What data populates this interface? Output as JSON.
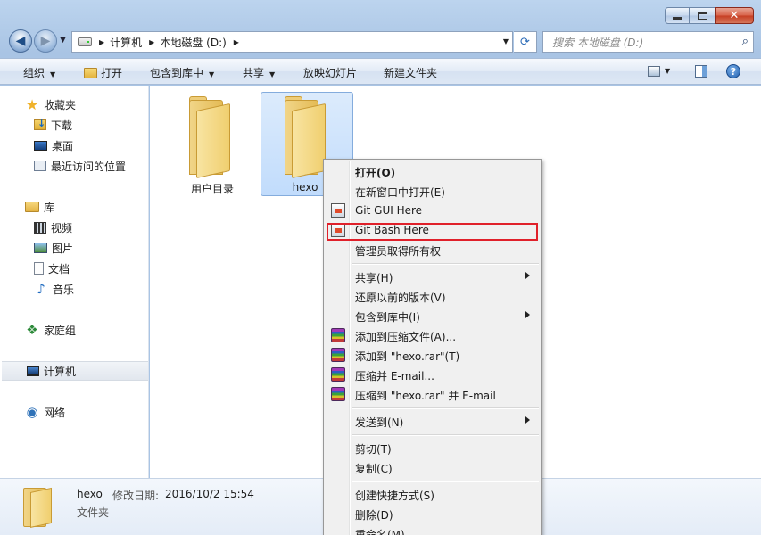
{
  "window": {
    "caption": {
      "minimize": "",
      "maximize": "",
      "close": "✕"
    }
  },
  "nav": {
    "back_glyph": "◀",
    "forward_glyph": "▶",
    "breadcrumbs": [
      "计算机",
      "本地磁盘 (D:)"
    ],
    "refresh_glyph": "⟳",
    "search_placeholder": "搜索 本地磁盘 (D:)",
    "search_glyph": "⌕"
  },
  "toolbar": {
    "organize": "组织",
    "open": "打开",
    "include_in_library": "包含到库中",
    "share": "共享",
    "slideshow": "放映幻灯片",
    "new_folder": "新建文件夹",
    "help": "?"
  },
  "sidebar": {
    "items": [
      {
        "label": "收藏夹",
        "icon": "star-icon"
      },
      {
        "label": "下载",
        "icon": "downloads-icon"
      },
      {
        "label": "桌面",
        "icon": "desktop-icon"
      },
      {
        "label": "最近访问的位置",
        "icon": "recent-places-icon"
      },
      {
        "label": "库",
        "icon": "library-icon"
      },
      {
        "label": "视频",
        "icon": "videos-icon"
      },
      {
        "label": "图片",
        "icon": "pictures-icon"
      },
      {
        "label": "文档",
        "icon": "documents-icon"
      },
      {
        "label": "音乐",
        "icon": "music-icon"
      },
      {
        "label": "家庭组",
        "icon": "homegroup-icon"
      },
      {
        "label": "计算机",
        "icon": "computer-icon"
      },
      {
        "label": "网络",
        "icon": "network-icon"
      }
    ]
  },
  "files": [
    {
      "name": "用户目录",
      "type": "folder"
    },
    {
      "name": "hexo",
      "type": "folder",
      "selected": true
    }
  ],
  "context_menu": {
    "items": [
      {
        "label": "打开(O)",
        "bold": true
      },
      {
        "label": "在新窗口中打开(E)"
      },
      {
        "label": "Git GUI Here",
        "icon": "git-gui-icon"
      },
      {
        "label": "Git Bash Here",
        "icon": "git-bash-icon",
        "highlighted": true
      },
      {
        "label": "管理员取得所有权"
      },
      {
        "label": "共享(H)",
        "submenu": true
      },
      {
        "label": "还原以前的版本(V)"
      },
      {
        "label": "包含到库中(I)",
        "submenu": true
      },
      {
        "label": "添加到压缩文件(A)...",
        "icon": "winrar-icon"
      },
      {
        "label": "添加到 \"hexo.rar\"(T)",
        "icon": "winrar-icon"
      },
      {
        "label": "压缩并 E-mail...",
        "icon": "winrar-icon"
      },
      {
        "label": "压缩到 \"hexo.rar\" 并 E-mail",
        "icon": "winrar-icon"
      },
      {
        "label": "发送到(N)",
        "submenu": true
      },
      {
        "label": "剪切(T)"
      },
      {
        "label": "复制(C)"
      },
      {
        "label": "创建快捷方式(S)"
      },
      {
        "label": "删除(D)"
      },
      {
        "label": "重命名(M)"
      }
    ],
    "highlight_color": "#e0202a"
  },
  "details": {
    "name": "hexo",
    "modified_label": "修改日期:",
    "modified_value": "2016/10/2 15:54",
    "type": "文件夹"
  }
}
